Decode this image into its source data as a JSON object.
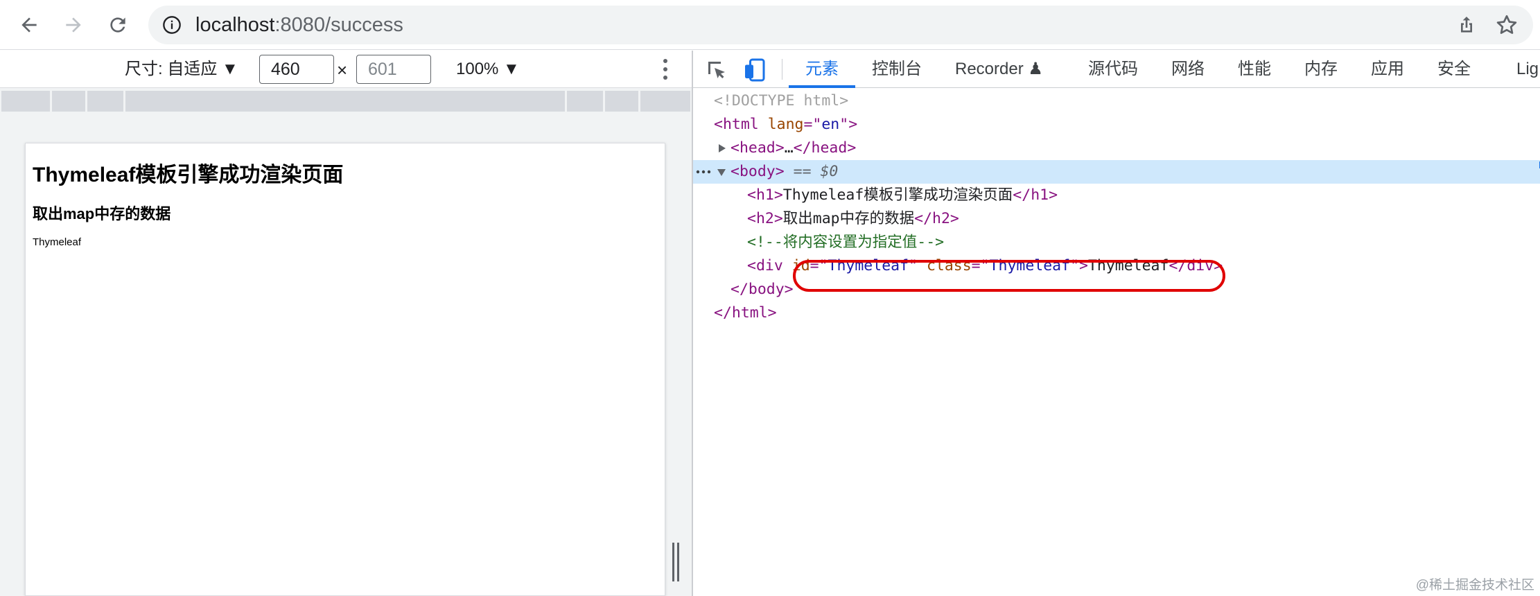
{
  "browser": {
    "url_host": "localhost",
    "url_rest": ":8080/success"
  },
  "device_toolbar": {
    "dimensions_label": "尺寸: 自适应 ▼",
    "width_value": "460",
    "height_value": "601",
    "times": "×",
    "zoom_label": "100% ▼"
  },
  "page": {
    "h1": "Thymeleaf模板引擎成功渲染页面",
    "h2": "取出map中存的数据",
    "div_text": "Thymeleaf"
  },
  "devtools": {
    "tabs": [
      {
        "label": "元素"
      },
      {
        "label": "控制台"
      },
      {
        "label": "Recorder ♟"
      },
      {
        "label": "源代码"
      },
      {
        "label": "网络"
      },
      {
        "label": "性能"
      },
      {
        "label": "内存"
      },
      {
        "label": "应用"
      },
      {
        "label": "安全"
      },
      {
        "label": "Lig"
      }
    ],
    "dom": {
      "doctype": "<!DOCTYPE html>",
      "html_open_tag": "html",
      "html_lang_attr": "lang",
      "html_lang_val": "en",
      "head_collapsed": "head",
      "head_ellipsis": "…",
      "body_tag": "body",
      "body_eq": "==",
      "body_dollar": "$0",
      "h1_text": "Thymeleaf模板引擎成功渲染页面",
      "h2_text": "取出map中存的数据",
      "comment": "<!--将内容设置为指定值-->",
      "div_id_attr": "id",
      "div_id_val": "Thymeleaf",
      "div_class_attr": "class",
      "div_class_val": "Thymeleaf",
      "div_text": "Thymeleaf",
      "body_close": "body",
      "html_close": "html"
    }
  },
  "watermark": "@稀土掘金技术社区",
  "colors": {
    "accent": "#1a73e8",
    "highlight_circle": "#e00000",
    "selected_row": "#cfe8fc"
  }
}
